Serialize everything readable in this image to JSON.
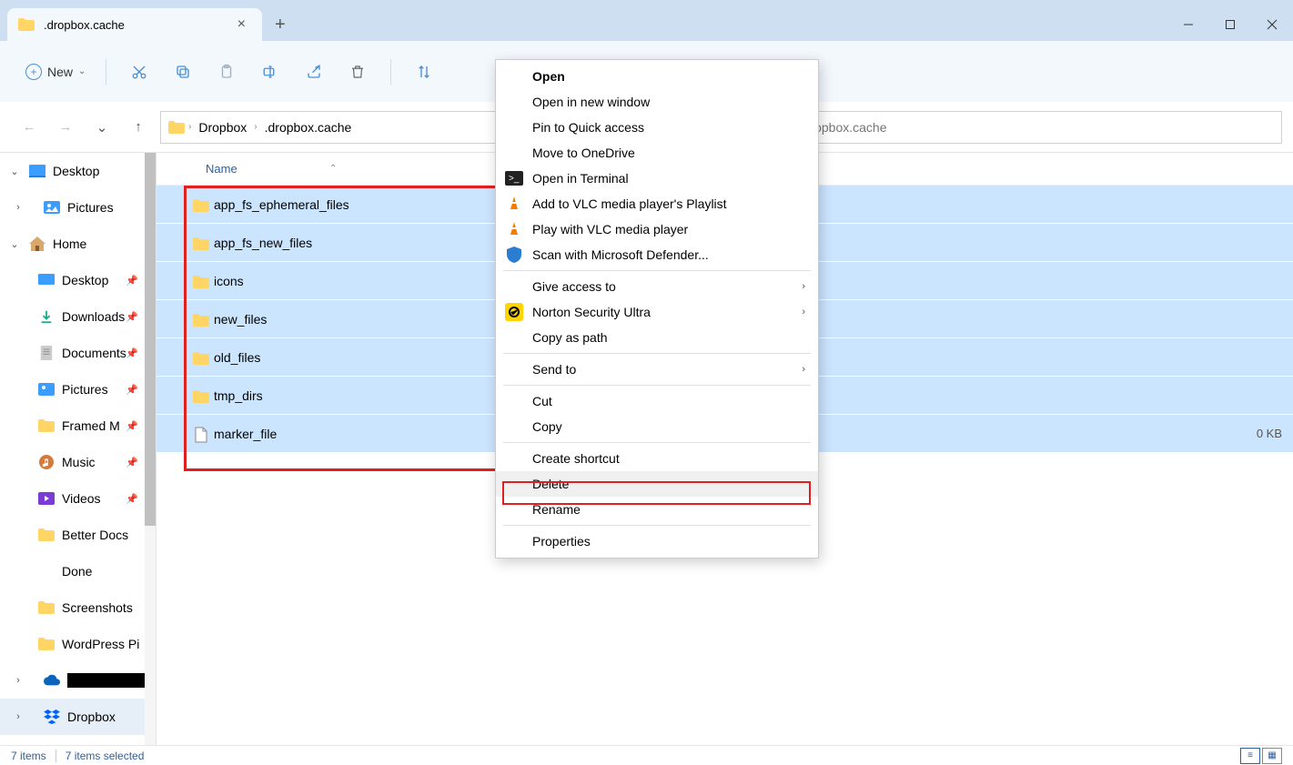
{
  "window": {
    "tab_title": ".dropbox.cache",
    "new_label": "New"
  },
  "breadcrumb": {
    "root": "Dropbox",
    "current": ".dropbox.cache"
  },
  "search": {
    "placeholder": "Search .dropbox.cache"
  },
  "sidebar": {
    "items": [
      {
        "label": "Desktop",
        "icon": "desktop"
      },
      {
        "label": "Pictures",
        "icon": "pictures"
      },
      {
        "label": "Home",
        "icon": "home"
      },
      {
        "label": "Desktop",
        "icon": "desktop-blue",
        "pinned": true
      },
      {
        "label": "Downloads",
        "icon": "downloads",
        "pinned": true
      },
      {
        "label": "Documents",
        "icon": "documents",
        "pinned": true
      },
      {
        "label": "Pictures",
        "icon": "pictures",
        "pinned": true
      },
      {
        "label": "Framed M",
        "icon": "folder",
        "pinned": true
      },
      {
        "label": "Music",
        "icon": "music",
        "pinned": true
      },
      {
        "label": "Videos",
        "icon": "videos",
        "pinned": true
      },
      {
        "label": "Better Docs",
        "icon": "folder"
      },
      {
        "label": "Done",
        "icon": "folder"
      },
      {
        "label": "Screenshots",
        "icon": "folder"
      },
      {
        "label": "WordPress Pi",
        "icon": "folder"
      },
      {
        "label": "",
        "icon": "onedrive"
      },
      {
        "label": "Dropbox",
        "icon": "dropbox"
      }
    ]
  },
  "list": {
    "header_name": "Name",
    "items": [
      {
        "name": "app_fs_ephemeral_files",
        "type": "folder"
      },
      {
        "name": "app_fs_new_files",
        "type": "folder"
      },
      {
        "name": "icons",
        "type": "folder"
      },
      {
        "name": "new_files",
        "type": "folder"
      },
      {
        "name": "old_files",
        "type": "folder"
      },
      {
        "name": "tmp_dirs",
        "type": "folder"
      },
      {
        "name": "marker_file",
        "type": "file",
        "size": "0 KB"
      }
    ]
  },
  "context_menu": {
    "items": [
      {
        "label": "Open",
        "bold": true
      },
      {
        "label": "Open in new window"
      },
      {
        "label": "Pin to Quick access"
      },
      {
        "label": "Move to OneDrive"
      },
      {
        "label": "Open in Terminal",
        "icon": "terminal"
      },
      {
        "label": "Add to VLC media player's Playlist",
        "icon": "vlc"
      },
      {
        "label": "Play with VLC media player",
        "icon": "vlc"
      },
      {
        "label": "Scan with Microsoft Defender...",
        "icon": "defender"
      },
      {
        "sep": true
      },
      {
        "label": "Give access to",
        "submenu": true
      },
      {
        "label": "Norton Security Ultra",
        "icon": "norton",
        "submenu": true
      },
      {
        "label": "Copy as path"
      },
      {
        "sep": true
      },
      {
        "label": "Send to",
        "submenu": true
      },
      {
        "sep": true
      },
      {
        "label": "Cut"
      },
      {
        "label": "Copy"
      },
      {
        "sep": true
      },
      {
        "label": "Create shortcut"
      },
      {
        "label": "Delete",
        "hover": true
      },
      {
        "label": "Rename"
      },
      {
        "sep": true
      },
      {
        "label": "Properties"
      }
    ]
  },
  "statusbar": {
    "items": "7 items",
    "selected": "7 items selected"
  }
}
